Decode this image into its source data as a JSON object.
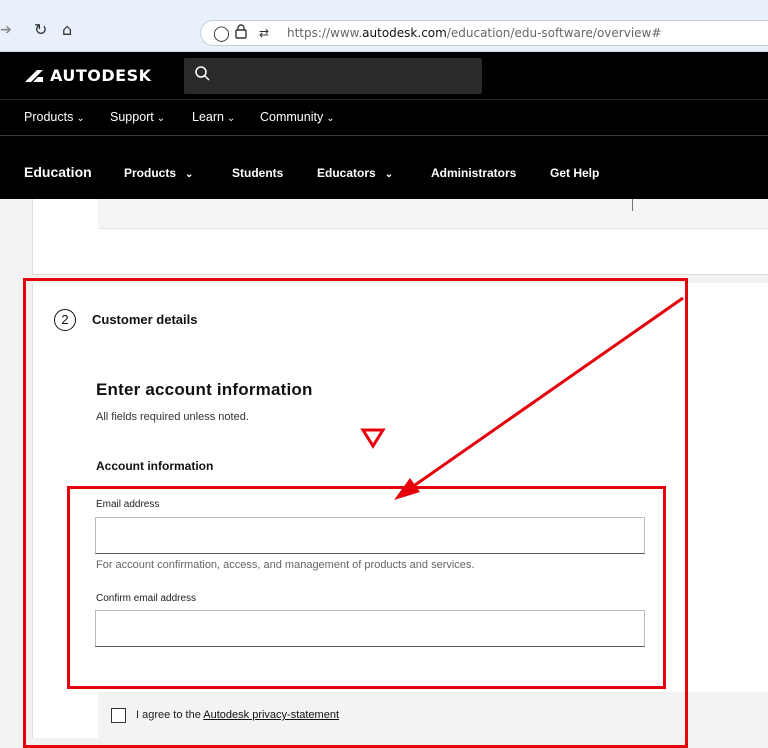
{
  "browser": {
    "url_prefix": "https://www.",
    "url_domain": "autodesk.com",
    "url_path": "/education/edu-software/overview#"
  },
  "header": {
    "brand": "AUTODESK",
    "search_placeholder": "",
    "nav": [
      {
        "label": "Products"
      },
      {
        "label": "Support"
      },
      {
        "label": "Learn"
      },
      {
        "label": "Community"
      }
    ]
  },
  "edu_nav": {
    "title": "Education",
    "items": [
      {
        "label": "Products"
      },
      {
        "label": "Students"
      },
      {
        "label": "Educators"
      },
      {
        "label": "Administrators"
      },
      {
        "label": "Get Help"
      }
    ]
  },
  "step": {
    "number": "2",
    "title": "Customer details"
  },
  "form": {
    "heading": "Enter account information",
    "subtitle": "All fields required unless noted.",
    "section_title": "Account information",
    "email_label": "Email address",
    "email_value": "",
    "email_help": "For account confirmation, access, and management of products and services.",
    "confirm_label": "Confirm email address",
    "confirm_value": "",
    "agree_prefix": "I agree to the ",
    "agree_link": "Autodesk privacy-statement"
  },
  "annotation": {
    "color": "#e5000b"
  }
}
